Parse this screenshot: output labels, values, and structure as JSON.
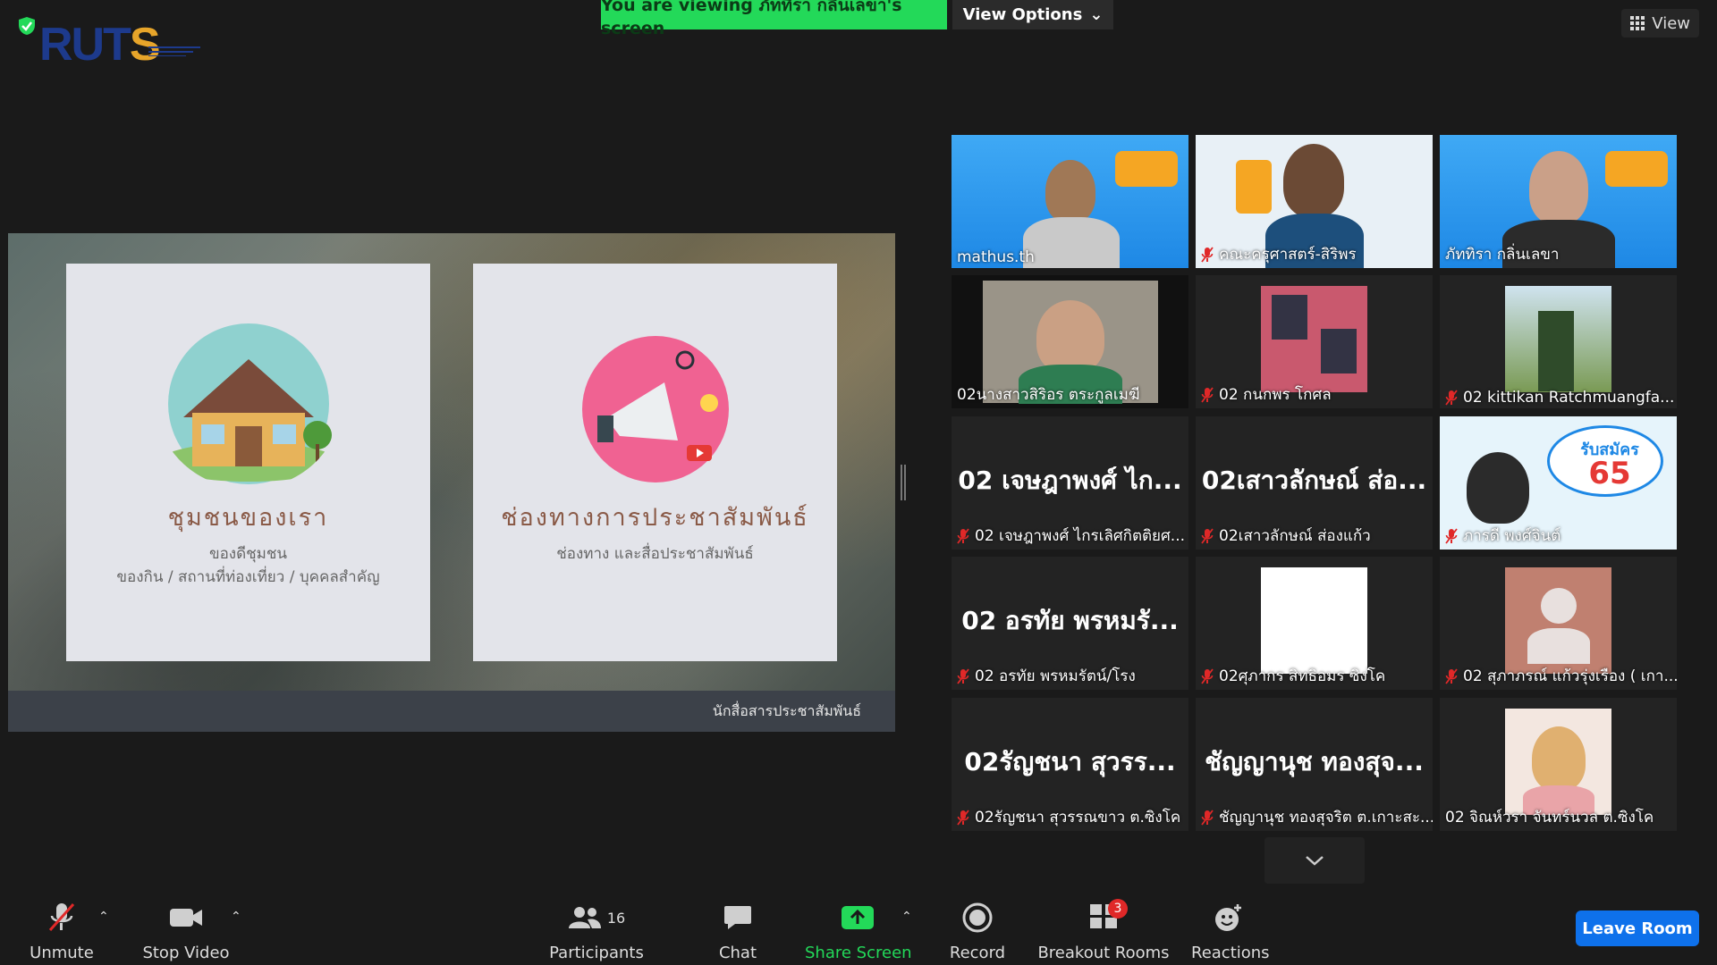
{
  "banner": {
    "text": "You are viewing ภัททิรา กลิ่นเลขา's screen",
    "color": "#23d959"
  },
  "view_options": {
    "label": "View Options"
  },
  "view_button": {
    "label": "View"
  },
  "logo": {
    "text": "RUTS"
  },
  "slide": {
    "cards": [
      {
        "title": "ชุมชนของเรา",
        "line1": "ของดีชุมชน",
        "line2": "ของกิน / สถานที่ท่องเที่ยว / บุคคลสำคัญ"
      },
      {
        "title": "ช่องทางการประชาสัมพันธ์",
        "line1": "ช่องทาง และสื่อประชาสัมพันธ์",
        "line2": ""
      }
    ],
    "footer": "นักสื่อสารประชาสัมพันธ์"
  },
  "participants_tiles": [
    {
      "name": "mathus.th",
      "muted": false,
      "video": true
    },
    {
      "name": "คณะครุศาสตร์-สิริพร",
      "muted": true,
      "video": true
    },
    {
      "name": "ภัททิรา กลิ่นเลขา",
      "muted": false,
      "video": true
    },
    {
      "name": "02นางสาวสิริอร  ตระกูลเมฆี",
      "muted": false,
      "video": true,
      "active": true
    },
    {
      "name": "02 กนกพร โกศล",
      "muted": true,
      "video": true
    },
    {
      "name": "02 kittikan Ratchmuangfa...",
      "muted": true,
      "video": true
    },
    {
      "name": "02 เจษฎาพงศ์ ไกรเลิศกิตติยศ...",
      "big": "02 เจษฎาพงศ์ ไก...",
      "muted": true,
      "video": false
    },
    {
      "name": "02เสาวลักษณ์ ส่องแก้ว",
      "big": "02เสาวลักษณ์ ส่อ...",
      "muted": true,
      "video": false
    },
    {
      "name": "ภารดี พงศ์จินต์",
      "muted": true,
      "video": true
    },
    {
      "name": "02 อรทัย พรหมรัตน์/โรง",
      "big": "02 อรทัย พรหมรั...",
      "muted": true,
      "video": false
    },
    {
      "name": "02ศุภากร สิทธิอมร ซิงโค",
      "muted": true,
      "video": true
    },
    {
      "name": "02 สุภาภรณ์ แก้วรุ่งเรือง ( เกา...",
      "muted": true,
      "video": true
    },
    {
      "name": "02รัญชนา สุวรรณขาว ต.ซิงโค",
      "big": "02รัญชนา สุวรร...",
      "muted": true,
      "video": false
    },
    {
      "name": "ชัญญานุช ทองสุจริต ต.เกาะสะ...",
      "big": "ชัญญานุช ทองสุจ...",
      "muted": true,
      "video": false
    },
    {
      "name": "02 จิณห์วรา จันทร์นวล ต.ซิงโค",
      "muted": false,
      "video": true
    }
  ],
  "promo": {
    "line1": "รับสมัคร",
    "line2": "65"
  },
  "toolbar": {
    "unmute": "Unmute",
    "stop_video": "Stop Video",
    "participants": "Participants",
    "participants_count": "16",
    "chat": "Chat",
    "share_screen": "Share Screen",
    "record": "Record",
    "breakout_rooms": "Breakout Rooms",
    "breakout_badge": "3",
    "reactions": "Reactions",
    "leave": "Leave Room"
  },
  "colors": {
    "leave": "#0e71eb",
    "share": "#23d959",
    "mute_red": "#e02828",
    "active_border": "#f2f266"
  }
}
